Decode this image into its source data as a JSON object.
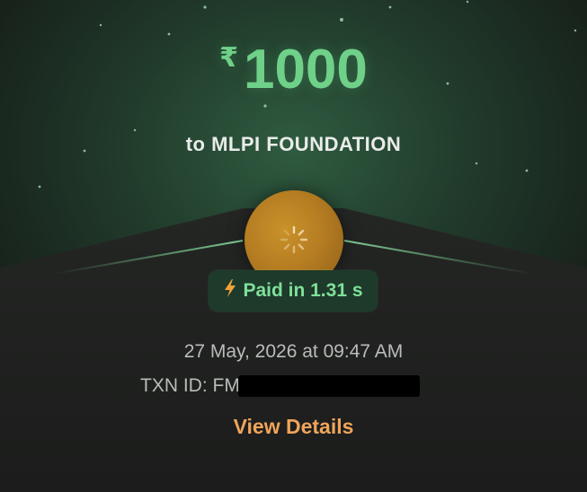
{
  "payment": {
    "currency_symbol": "₹",
    "amount": "1000",
    "recipient_text": "to MLPI FOUNDATION",
    "status_text": "Paid in 1.31 s",
    "datetime": "27 May, 2026 at 09:47 AM",
    "txn_label": "TXN ID: FM",
    "view_details_label": "View Details"
  },
  "icons": {
    "status": "lightning-bolt-icon",
    "loading": "loading-spinner-icon"
  },
  "colors": {
    "amount": "#6fd189",
    "badge_text": "#7fe09a",
    "badge_bg": "#1e3a2a",
    "bolt": "#f2a23a",
    "link": "#f0a45a",
    "orb": "#b67d22"
  }
}
